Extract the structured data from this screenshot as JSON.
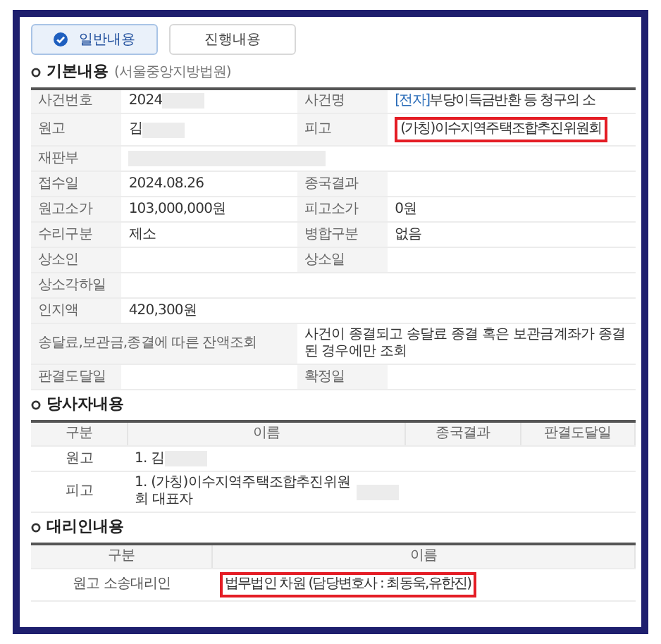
{
  "tabs": [
    {
      "label": "일반내용",
      "selected": true
    },
    {
      "label": "진행내용",
      "selected": false
    }
  ],
  "basic": {
    "title": "기본내용",
    "subtitle": "(서울중앙지방법원)",
    "rows": [
      {
        "kind": "pairs",
        "cells": [
          {
            "label": "사건번호",
            "value": "2024",
            "redacted": true
          },
          {
            "label": "사건명",
            "tag": "[전자]",
            "value": "부당이득금반환 등 청구의 소"
          }
        ]
      },
      {
        "kind": "pairs",
        "cells": [
          {
            "label": "원고",
            "value": "김",
            "redacted": true
          },
          {
            "label": "피고",
            "value": "(가칭)이수지역주택조합추진위원회",
            "highlighted": true
          }
        ]
      },
      {
        "kind": "single",
        "cells": [
          {
            "label": "재판부",
            "redacted": true
          }
        ]
      },
      {
        "kind": "pairs",
        "cells": [
          {
            "label": "접수일",
            "value": "2024.08.26"
          },
          {
            "label": "종국결과"
          }
        ]
      },
      {
        "kind": "pairs",
        "cells": [
          {
            "label": "원고소가",
            "value": "103,000,000원"
          },
          {
            "label": "피고소가",
            "value": "0원"
          }
        ]
      },
      {
        "kind": "pairs",
        "cells": [
          {
            "label": "수리구분",
            "value": "제소"
          },
          {
            "label": "병합구분",
            "value": "없음"
          }
        ]
      },
      {
        "kind": "pairs",
        "cells": [
          {
            "label": "상소인"
          },
          {
            "label": "상소일"
          }
        ]
      },
      {
        "kind": "single",
        "cells": [
          {
            "label": "상소각하일"
          }
        ]
      },
      {
        "kind": "single",
        "cells": [
          {
            "label": "인지액",
            "value": "420,300원"
          }
        ]
      },
      {
        "kind": "split",
        "cells": [
          {
            "label": "송달료,보관금,종결에 따른 잔액조회",
            "value": "사건이 종결되고 송달료 종결 혹은 보관금계좌가 종결된 경우에만 조회"
          }
        ]
      },
      {
        "kind": "pairs",
        "cells": [
          {
            "label": "판결도달일"
          },
          {
            "label": "확정일"
          }
        ]
      }
    ]
  },
  "parties": {
    "title": "당사자내용",
    "columns": [
      "구분",
      "이름",
      "종국결과",
      "판결도달일"
    ],
    "rows": [
      {
        "cells": [
          {
            "value": "원고"
          },
          {
            "value": "1. 김",
            "redacted": true
          },
          {},
          {}
        ]
      },
      {
        "cells": [
          {
            "value": "피고"
          },
          {
            "value": "1. (가칭)이수지역주택조합추진위원회 대표자",
            "redacted": true
          },
          {},
          {}
        ]
      }
    ]
  },
  "agents": {
    "title": "대리인내용",
    "columns": [
      "구분",
      "이름"
    ],
    "rows": [
      {
        "cells": [
          {
            "value": "원고 소송대리인"
          },
          {
            "value": "법무법인 차원 (담당변호사 : 최동욱,유한진)",
            "highlighted": true
          }
        ]
      }
    ]
  }
}
